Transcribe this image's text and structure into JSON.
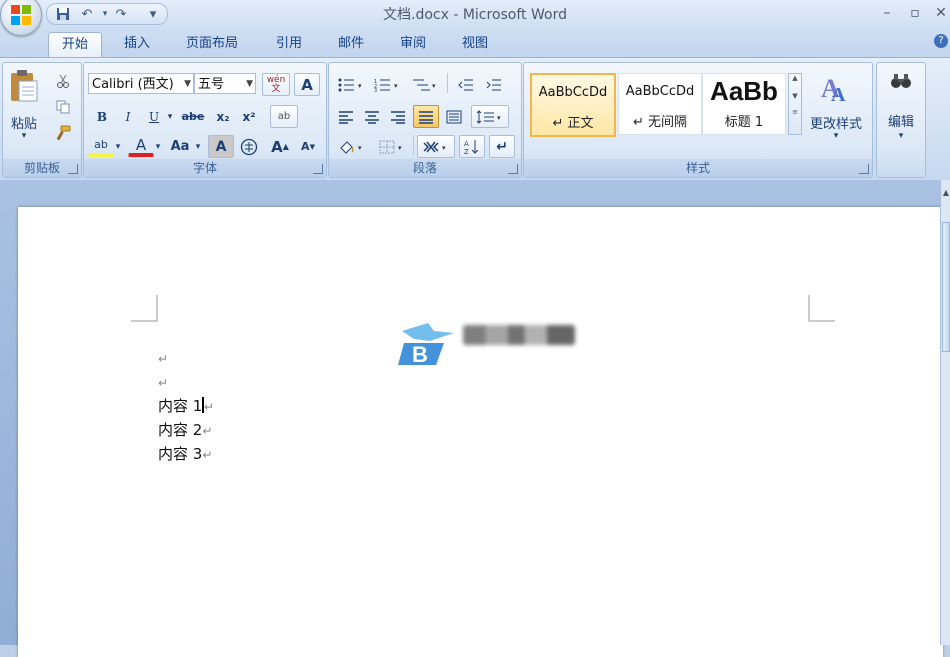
{
  "window": {
    "title": "文档.docx - Microsoft Word",
    "minimize_glyph": "–",
    "maximize_glyph": "▫",
    "close_glyph": "✕"
  },
  "quick_access": {
    "icons": [
      "save-icon",
      "undo-icon",
      "redo-icon",
      "customize-icon"
    ],
    "undo_glyph": "↶",
    "redo_glyph": "↷",
    "customize_glyph": "▾"
  },
  "tabs": [
    {
      "label": "开始",
      "active": true
    },
    {
      "label": "插入"
    },
    {
      "label": "页面布局"
    },
    {
      "label": "引用"
    },
    {
      "label": "邮件"
    },
    {
      "label": "审阅"
    },
    {
      "label": "视图"
    }
  ],
  "help_glyph": "?",
  "clipboard": {
    "group_label": "剪贴板",
    "paste_label": "粘贴",
    "icons": [
      "paste-icon",
      "cut-icon",
      "copy-icon",
      "format-painter-icon"
    ]
  },
  "font": {
    "group_label": "字体",
    "font_name": "Calibri (西文)",
    "font_size": "五号",
    "phonetic_guide": "wén\n文",
    "char_border": "A",
    "bold": "B",
    "italic": "I",
    "underline": "U",
    "strikethrough": "abe",
    "subscript": "x₂",
    "superscript": "x²",
    "clear_format": "ab",
    "highlight": "ab",
    "font_color": "A",
    "change_case": "Aa",
    "char_shading": "A",
    "enclose_char": "字",
    "grow_font": "A",
    "shrink_font": "A"
  },
  "paragraph": {
    "group_label": "段落",
    "icons": [
      "bullets-icon",
      "numbering-icon",
      "multilevel-list-icon",
      "decrease-indent-icon",
      "increase-indent-icon",
      "align-left-icon",
      "align-center-icon",
      "align-right-icon",
      "justify-icon",
      "distributed-icon",
      "line-spacing-icon",
      "shading-icon",
      "borders-icon",
      "chinese-layout-icon",
      "sort-icon",
      "show-marks-icon"
    ]
  },
  "styles": {
    "group_label": "样式",
    "items": [
      {
        "sample": "AaBbCcDd",
        "name": "↵ 正文",
        "active": true
      },
      {
        "sample": "AaBbCcDd",
        "name": "↵ 无间隔"
      },
      {
        "sample": "AaBb",
        "name": "标题 1"
      }
    ],
    "change_styles_label": "更改样式"
  },
  "editing": {
    "label": "编辑",
    "icon": "binoculars-icon"
  },
  "document": {
    "paragraph_mark": "↵",
    "lines": [
      "内容 1",
      "内容 2",
      "内容 3"
    ],
    "cursor_line": 0
  },
  "colors": {
    "tab_text": "#15428b",
    "active_style_border": "#f2b64a",
    "font_color_bar": "#e02020",
    "highlight_bar": "#f5f542"
  }
}
